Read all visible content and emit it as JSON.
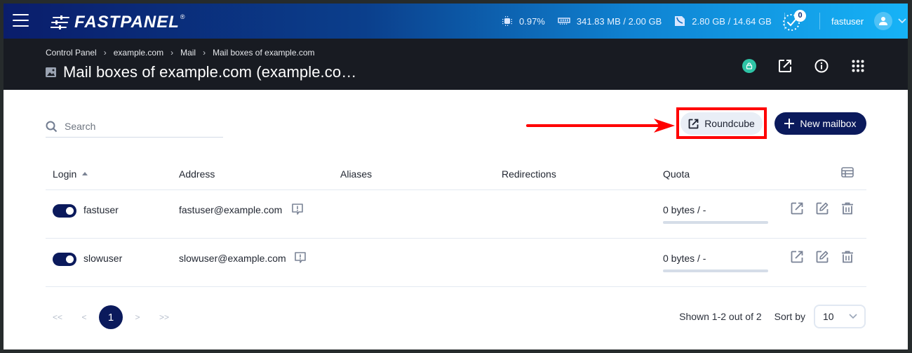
{
  "topbar": {
    "brand": "FASTPANEL",
    "brand_mark": "®",
    "stats": {
      "cpu": "0.97%",
      "ram": "341.83 MB / 2.00 GB",
      "disk": "2.80 GB / 14.64 GB"
    },
    "tasks_badge": "0",
    "username": "fastuser"
  },
  "subheader": {
    "breadcrumb": [
      "Control Panel",
      "example.com",
      "Mail",
      "Mail boxes of example.com"
    ],
    "title": "Mail boxes of example.com (example.co…",
    "ssl_color": "#2ec4a6"
  },
  "toolbar": {
    "search_placeholder": "Search",
    "search_value": "",
    "roundcube_label": "Roundcube",
    "new_mailbox_label": "New mailbox",
    "annotation_color": "#ff0000"
  },
  "table": {
    "columns": [
      "Login",
      "Address",
      "Aliases",
      "Redirections",
      "Quota"
    ],
    "sort_column": "Login",
    "sort_direction": "asc",
    "rows": [
      {
        "enabled": true,
        "login": "fastuser",
        "address": "fastuser@example.com",
        "aliases": "",
        "redirections": "",
        "quota": "0 bytes / -",
        "quota_used_fraction": 0
      },
      {
        "enabled": true,
        "login": "slowuser",
        "address": "slowuser@example.com",
        "aliases": "",
        "redirections": "",
        "quota": "0 bytes / -",
        "quota_used_fraction": 0
      }
    ]
  },
  "pagination": {
    "first": "<<",
    "prev": "<",
    "current": "1",
    "next": ">",
    "last": ">>",
    "shown": "Shown 1-2 out of 2",
    "sort_by_label": "Sort by",
    "page_size": "10"
  },
  "colors": {
    "primary": "#0b1a5c",
    "subheader_bg": "#181b22",
    "accent_teal": "#2ec4a6"
  }
}
